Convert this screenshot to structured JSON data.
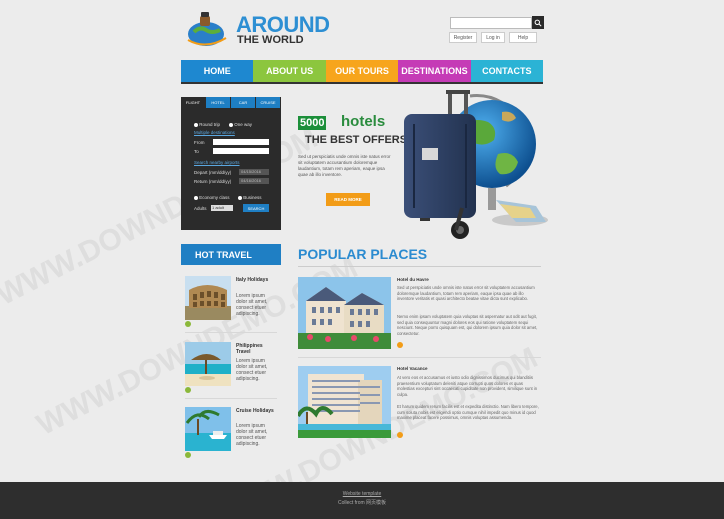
{
  "logo": {
    "line1": "AROUND",
    "line2": "THE WORLD"
  },
  "header": {
    "search_placeholder": "",
    "links": [
      "Register",
      "Log in",
      "Help"
    ]
  },
  "nav": [
    {
      "label": "HOME",
      "color": "#1e88d0"
    },
    {
      "label": "ABOUT US",
      "color": "#8cc63e"
    },
    {
      "label": "OUR TOURS",
      "color": "#f7a51c"
    },
    {
      "label": "DESTINATIONS",
      "color": "#c53bb6"
    },
    {
      "label": "CONTACTS",
      "color": "#2bb3d5"
    }
  ],
  "booking": {
    "tabs": [
      "FLIGHT",
      "HOTEL",
      "CAR",
      "CRUISE"
    ],
    "round_trip": "Round trip",
    "one_way": "One way",
    "multiple": "Multiple destinations",
    "from": "From",
    "to": "To",
    "nearby": "Search nearby airports",
    "depart": "Depart (mm/dd/yy)",
    "return": "Return (mm/dd/yy)",
    "depart_val": "04/15/2016",
    "return_val": "04/16/2016",
    "economy": "Economy class",
    "business": "Business",
    "adults": "Adults",
    "adults_val": "1 adult",
    "search": "SEARCH"
  },
  "hero": {
    "badge": "5000",
    "word": "hotels",
    "subtitle": "THE BEST OFFERS",
    "text": "Sed ut perspiciatis unde omnis iste natus error sit voluptatem accusantium doloremque laudantium, totam rem aperiam, eaque ipsa quae ab illo inventore.",
    "button": "READ MORE"
  },
  "hot_travel": {
    "title": "HOT TRAVEL",
    "items": [
      {
        "title": "Italy Holidays",
        "desc": "Lorem ipsum dolor sit amet, consect etuer adipiscing."
      },
      {
        "title": "Philippines Travel",
        "desc": "Lorem ipsum dolor sit amet, consect etuer adipiscing."
      },
      {
        "title": "Cruise Holidays",
        "desc": "Lorem ipsum dolor sit amet, consect etuer adipiscing."
      }
    ]
  },
  "popular": {
    "title": "POPULAR PLACES",
    "items": [
      {
        "title": "Hotel du Havre",
        "p1": "Sed ut perspiciatis unde omnis iste natus error sit voluptatem accusantium doloremque laudantium, totam rem aperiam, eaque ipsa quae ab illo inventore veritatis et quasi architecto beatae vitae dicta sunt explicabo.",
        "p2": "Nemo enim ipsam voluptatem quia voluptas sit aspernatur aut odit aut fugit, sed quia consequuntur magni dolores eos qui ratione voluptatem sequi nesciunt. Neque porro quisquam est, qui dolorem ipsum quia dolor sit amet, consectetur."
      },
      {
        "title": "Hotel Vacance",
        "p1": "At vero eos et accusamus et iusto odio dignissimos ducimus qui blanditiis praesentium voluptatum deleniti atque corrupti quos dolores et quas molestias excepturi sint occaecati cupiditate non provident, similique sunt in culpa.",
        "p2": "Et harum quidem rerum facilis est et expedita distinctio. Nam libero tempore, cum soluta nobis est eligendi optio cumque nihil impedit quo minus id quod maxime placeat facere possimus, omnis voluptas assumenda."
      }
    ]
  },
  "footer": {
    "line1": "Website template",
    "line2": "Collect from 网页模板"
  },
  "watermark": "WWW.DOWNDEMO.COM"
}
